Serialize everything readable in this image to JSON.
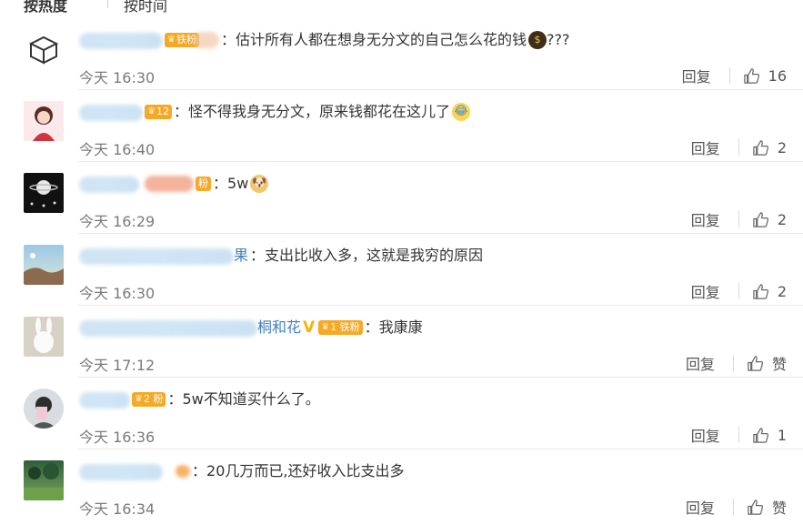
{
  "sort": {
    "hot": "按热度",
    "time": "按时间"
  },
  "comments": [
    {
      "user_visible": "好·你该莱格",
      "badge": "铁粉",
      "badge_level": "",
      "text": "估计所有人都在想身无分文的自己怎么花的钱",
      "emoji": "money-bag-emoji",
      "suffix": " ???",
      "time": "今天 16:30",
      "reply": "回复",
      "likes": "16"
    },
    {
      "user_visible": "七忆故意",
      "badge": "",
      "badge_level": "12",
      "text": "怪不得我身无分文，原来钱都花在这儿了",
      "emoji": "crying-laugh-emoji",
      "suffix": "",
      "time": "今天 16:40",
      "reply": "回复",
      "likes": "2"
    },
    {
      "user_visible": "",
      "badge": "粉",
      "badge_level": "",
      "text": "5w",
      "emoji": "doge-emoji",
      "suffix": "",
      "time": "今天 16:29",
      "reply": "回复",
      "likes": "2"
    },
    {
      "user_visible": "佔昆",
      "user_tail": "果",
      "badge": "",
      "badge_level": "",
      "text": "支出比收入多，这就是我穷的原因",
      "emoji": "",
      "suffix": "",
      "time": "今天 16:30",
      "reply": "回复",
      "likes": "2"
    },
    {
      "user_visible": "",
      "user_tail": "桐和花",
      "badge": "铁粉",
      "badge_level": "1",
      "text": "我康康",
      "emoji": "",
      "suffix": "",
      "time": "今天 17:12",
      "reply": "回复",
      "likes": "赞"
    },
    {
      "user_visible": "沼之",
      "badge": "粉",
      "badge_level": "2",
      "text": "5w不知道买什么了。",
      "emoji": "",
      "suffix": "",
      "time": "今天 16:36",
      "reply": "回复",
      "likes": "1"
    },
    {
      "user_visible": "-",
      "badge": "",
      "badge_level": "",
      "text": "20几万而已,还好收入比支出多",
      "emoji": "",
      "suffix": "",
      "time": "今天 16:34",
      "reply": "回复",
      "likes": "赞"
    }
  ],
  "colors": {
    "username": "#3f7fc4",
    "badge": "#f6a827",
    "time": "#7a7a7a",
    "text": "#333333"
  }
}
